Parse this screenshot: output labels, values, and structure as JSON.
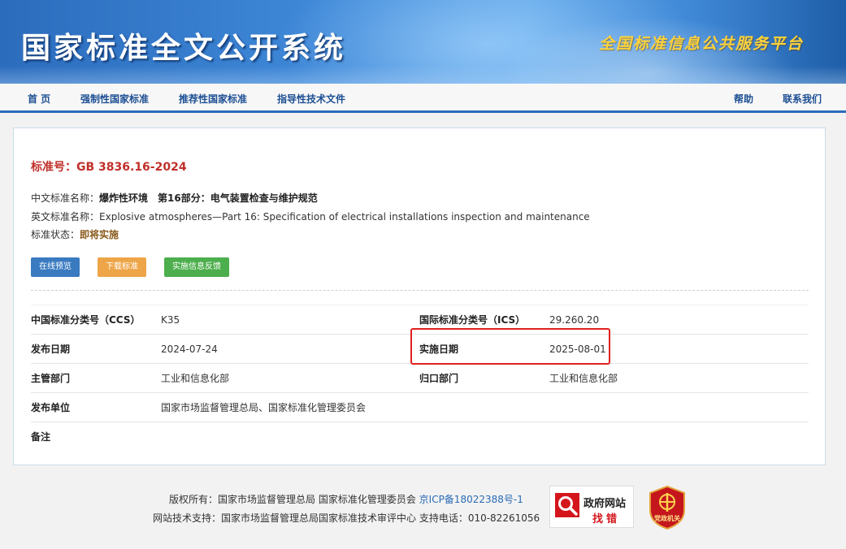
{
  "header": {
    "site_title": "国家标准全文公开系统",
    "slogan": "全国标准信息公共服务平台"
  },
  "nav": {
    "items": [
      "首 页",
      "强制性国家标准",
      "推荐性国家标准",
      "指导性技术文件"
    ],
    "right_items": [
      "帮助",
      "联系我们"
    ]
  },
  "standard": {
    "number_label": "标准号：",
    "number": "GB 3836.16-2024",
    "cn_name_label": "中文标准名称：",
    "cn_name": "爆炸性环境　第16部分：电气装置检查与维护规范",
    "en_name_label": "英文标准名称：",
    "en_name": "Explosive atmospheres—Part 16: Specification of electrical installations inspection and maintenance",
    "status_label": "标准状态：",
    "status": "即将实施"
  },
  "actions": {
    "preview": "在线预览",
    "download": "下载标准",
    "feedback": "实施信息反馈"
  },
  "details": {
    "ccs_label": "中国标准分类号（CCS）",
    "ccs": "K35",
    "ics_label": "国际标准分类号（ICS）",
    "ics": "29.260.20",
    "publish_label": "发布日期",
    "publish": "2024-07-24",
    "effective_label": "实施日期",
    "effective": "2025-08-01",
    "authority_label": "主管部门",
    "authority": "工业和信息化部",
    "owner_label": "归口部门",
    "owner": "工业和信息化部",
    "issuer_label": "发布单位",
    "issuer": "国家市场监督管理总局、国家标准化管理委员会",
    "remark_label": "备注",
    "remark": ""
  },
  "footer": {
    "copyright": "版权所有：国家市场监督管理总局 国家标准化管理委员会",
    "icp": "京ICP备18022388号-1",
    "support": "网站技术支持：国家市场监督管理总局国家标准技术审评中心 支持电话：010-82261056",
    "gov_badge_line1": "政府网站",
    "gov_badge_line2": "找错",
    "party_badge": "党政机关"
  },
  "colors": {
    "banner_blue": "#3d86d6",
    "nav_text": "#1d4f93",
    "std_number_red": "#c0302a",
    "btn_blue": "#3a7ac0",
    "btn_orange": "#eea548",
    "btn_green": "#4cae4c",
    "highlight_red": "#e02020"
  }
}
